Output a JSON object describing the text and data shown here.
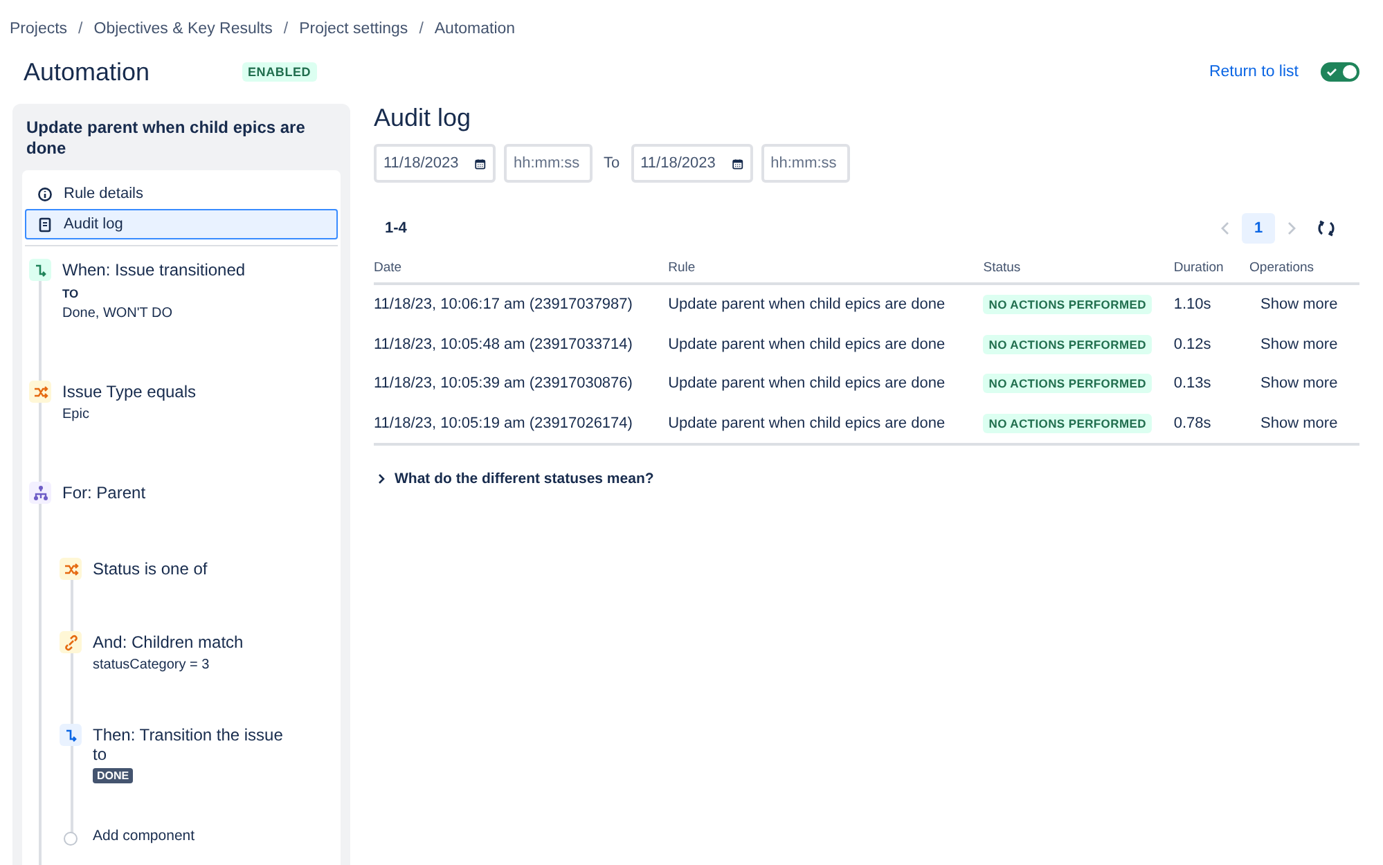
{
  "breadcrumbs": [
    "Projects",
    "Objectives & Key Results",
    "Project settings",
    "Automation"
  ],
  "breadcrumb_separator": "/",
  "header": {
    "title": "Automation",
    "status_badge": "ENABLED",
    "return_link": "Return to list",
    "toggle": {
      "on": true
    }
  },
  "sidebar": {
    "rule_name": "Update parent when child epics are done",
    "nav": [
      {
        "kind": "info",
        "label": "Rule details",
        "selected": false
      },
      {
        "kind": "log",
        "label": "Audit log",
        "selected": true
      }
    ],
    "steps": [
      {
        "kind": "trigger",
        "title": "When: Issue transitioned",
        "label": "TO",
        "detail": "Done, WON'T DO"
      },
      {
        "kind": "condition",
        "title": "Issue Type equals",
        "detail": "Epic"
      },
      {
        "kind": "branch",
        "title": "For: Parent",
        "children": [
          {
            "kind": "condition",
            "title": "Status is one of"
          },
          {
            "kind": "and",
            "title": "And: Children match",
            "detail": "statusCategory = 3"
          },
          {
            "kind": "action",
            "title": "Then: Transition the issue to",
            "badge": "DONE"
          },
          {
            "kind": "add",
            "title": "Add component"
          }
        ]
      }
    ]
  },
  "main": {
    "title": "Audit log",
    "filter": {
      "from_date": "11/18/2023",
      "from_time_placeholder": "hh:mm:ss",
      "to_label": "To",
      "to_date": "11/18/2023",
      "to_time_placeholder": "hh:mm:ss"
    },
    "range": "1-4",
    "pages": [
      {
        "label": "1",
        "selected": true
      }
    ],
    "table": {
      "columns": [
        "Date",
        "Rule",
        "Status",
        "Duration",
        "Operations"
      ],
      "rows": [
        {
          "date": "11/18/23, 10:06:17 am (23917037987)",
          "rule": "Update parent when child epics are done",
          "status": "NO ACTIONS PERFORMED",
          "duration": "1.10s",
          "operation": "Show more"
        },
        {
          "date": "11/18/23, 10:05:48 am (23917033714)",
          "rule": "Update parent when child epics are done",
          "status": "NO ACTIONS PERFORMED",
          "duration": "0.12s",
          "operation": "Show more"
        },
        {
          "date": "11/18/23, 10:05:39 am (23917030876)",
          "rule": "Update parent when child epics are done",
          "status": "NO ACTIONS PERFORMED",
          "duration": "0.13s",
          "operation": "Show more"
        },
        {
          "date": "11/18/23, 10:05:19 am (23917026174)",
          "rule": "Update parent when child epics are done",
          "status": "NO ACTIONS PERFORMED",
          "duration": "0.78s",
          "operation": "Show more"
        }
      ]
    },
    "help": {
      "label": "What do the different statuses mean?",
      "expanded": false
    }
  }
}
